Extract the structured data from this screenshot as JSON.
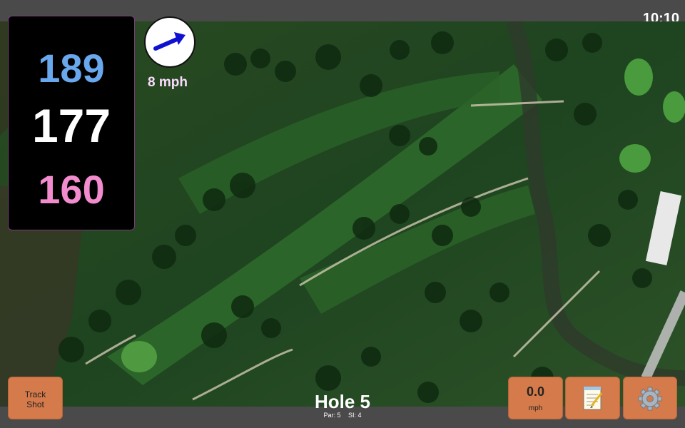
{
  "status_bar": {
    "time": "10:10"
  },
  "distances": {
    "back": "189",
    "center": "177",
    "front": "160",
    "colors": {
      "back": "#6aa8ee",
      "center": "#ffffff",
      "front": "#f28ccf"
    }
  },
  "wind": {
    "speed": "8 mph",
    "icon": "wind-arrow-icon",
    "arrow_color": "#1010d0"
  },
  "hole": {
    "title": "Hole 5",
    "par": "Par: 5",
    "si": "SI: 4"
  },
  "buttons": {
    "track_shot": {
      "line1": "Track",
      "line2": "Shot"
    },
    "speed": {
      "value": "0.0",
      "unit": "mph"
    },
    "notes": {
      "icon": "notepad-icon"
    },
    "settings": {
      "icon": "gear-icon"
    }
  },
  "colors": {
    "button": "#d47a4b",
    "bar": "#4a4a4a"
  }
}
